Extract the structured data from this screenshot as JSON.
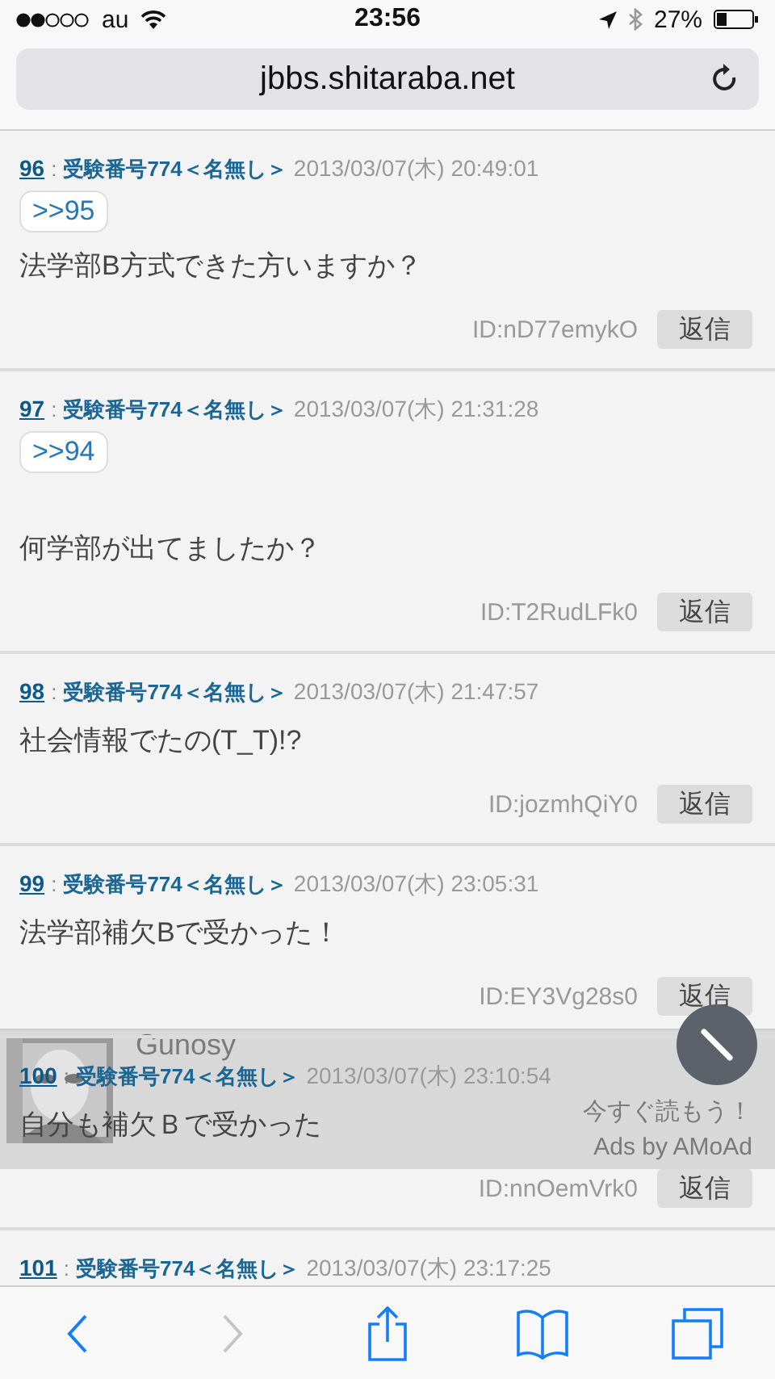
{
  "status_bar": {
    "carrier": "au",
    "time": "23:56",
    "battery": "27%"
  },
  "address_bar": {
    "url": "jbbs.shitaraba.net"
  },
  "posts": [
    {
      "number": "96",
      "separator": ":",
      "name": "受験番号774＜名無し＞",
      "date": "2013/03/07(木) 20:49:01",
      "anchor": ">>95",
      "body": "法学部B方式できた方いますか？",
      "id": "ID:nD77emykO",
      "reply": "返信"
    },
    {
      "number": "97",
      "separator": ":",
      "name": "受験番号774＜名無し＞",
      "date": "2013/03/07(木) 21:31:28",
      "anchor": ">>94",
      "body": "\n何学部が出てましたか？",
      "id": "ID:T2RudLFk0",
      "reply": "返信"
    },
    {
      "number": "98",
      "separator": ":",
      "name": "受験番号774＜名無し＞",
      "date": "2013/03/07(木) 21:47:57",
      "body": "社会情報でたの(T_T)!?",
      "id": "ID:jozmhQiY0",
      "reply": "返信"
    },
    {
      "number": "99",
      "separator": ":",
      "name": "受験番号774＜名無し＞",
      "date": "2013/03/07(木) 23:05:31",
      "body": "法学部補欠Bで受かった！",
      "id": "ID:EY3Vg28s0",
      "reply": "返信"
    },
    {
      "number": "100",
      "separator": ":",
      "name": "受験番号774＜名無し＞",
      "date": "2013/03/07(木) 23:10:54",
      "body": "自分も補欠Ｂで受かった",
      "id": "ID:nnOemVrk0",
      "reply": "返信"
    },
    {
      "number": "101",
      "separator": ":",
      "name": "受験番号774＜名無し＞",
      "date": "2013/03/07(木) 23:17:25"
    }
  ],
  "ad": {
    "source": "Gunosy",
    "headline": "今すぐ読もう！",
    "credit": "Ads by AMoAd"
  },
  "toolbar": {
    "back_disabled": false,
    "forward_disabled": true
  }
}
